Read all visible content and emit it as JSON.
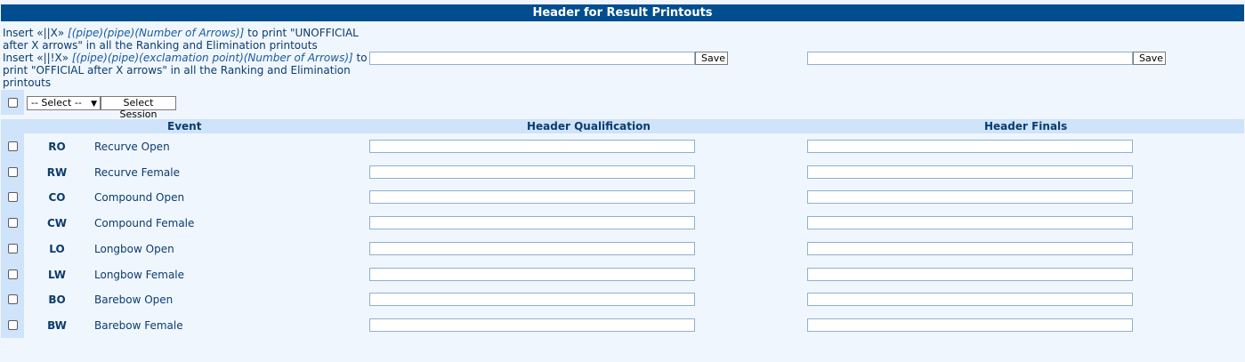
{
  "title": "Header for Result Printouts",
  "instructions": {
    "line1_a": "Insert «||X» ",
    "line1_i": "[(pipe)(pipe)(Number of Arrows)]",
    "line1_b": " to print \"UNOFFICIAL after X arrows\" in all the Ranking and Elimination printouts",
    "line2_a": "Insert «||!X» ",
    "line2_i": "[(pipe)(pipe)(exclamation point)(Number of Arrows)]",
    "line2_b": " to print \"OFFICIAL after X arrows\" in all the Ranking and Elimination printouts"
  },
  "top_inputs": {
    "qualification_value": "",
    "finals_value": "",
    "save_label": "Save"
  },
  "session": {
    "select_value": "-- Select --",
    "button_label": "Select Session"
  },
  "columns": {
    "event": "Event",
    "header_qualification": "Header Qualification",
    "header_finals": "Header Finals"
  },
  "events": [
    {
      "code": "RO",
      "name": "Recurve Open",
      "qualification": "",
      "finals": ""
    },
    {
      "code": "RW",
      "name": "Recurve Female",
      "qualification": "",
      "finals": ""
    },
    {
      "code": "CO",
      "name": "Compound Open",
      "qualification": "",
      "finals": ""
    },
    {
      "code": "CW",
      "name": "Compound Female",
      "qualification": "",
      "finals": ""
    },
    {
      "code": "LO",
      "name": "Longbow Open",
      "qualification": "",
      "finals": ""
    },
    {
      "code": "LW",
      "name": "Longbow Female",
      "qualification": "",
      "finals": ""
    },
    {
      "code": "BO",
      "name": "Barebow Open",
      "qualification": "",
      "finals": ""
    },
    {
      "code": "BW",
      "name": "Barebow Female",
      "qualification": "",
      "finals": ""
    }
  ],
  "colors": {
    "title_bar": "#004d8f",
    "header_row": "#cfe3fa",
    "page_bg": "#f0f6fd",
    "text": "#0b3c6e"
  }
}
